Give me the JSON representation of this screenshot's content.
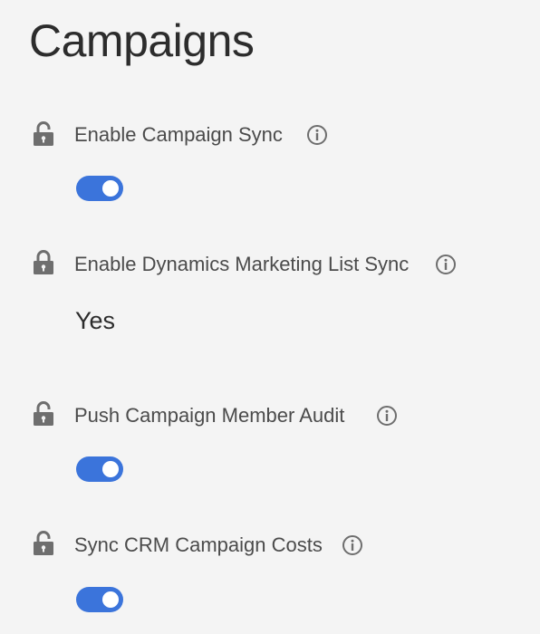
{
  "page": {
    "title": "Campaigns"
  },
  "colors": {
    "toggle_on": "#3b74db",
    "icon": "#6e6e6e",
    "background": "#f4f4f4"
  },
  "settings": [
    {
      "label": "Enable Campaign Sync",
      "lock_icon": "lock-open-icon",
      "info_icon": "info-icon",
      "control": "toggle",
      "toggle_on": true
    },
    {
      "label": "Enable Dynamics Marketing List Sync",
      "lock_icon": "lock-closed-icon",
      "info_icon": "info-icon",
      "control": "value",
      "value": "Yes"
    },
    {
      "label": "Push Campaign Member Audit",
      "lock_icon": "lock-open-icon",
      "info_icon": "info-icon",
      "control": "toggle",
      "toggle_on": true
    },
    {
      "label": "Sync CRM Campaign Costs",
      "lock_icon": "lock-open-icon",
      "info_icon": "info-icon",
      "control": "toggle",
      "toggle_on": true
    }
  ]
}
